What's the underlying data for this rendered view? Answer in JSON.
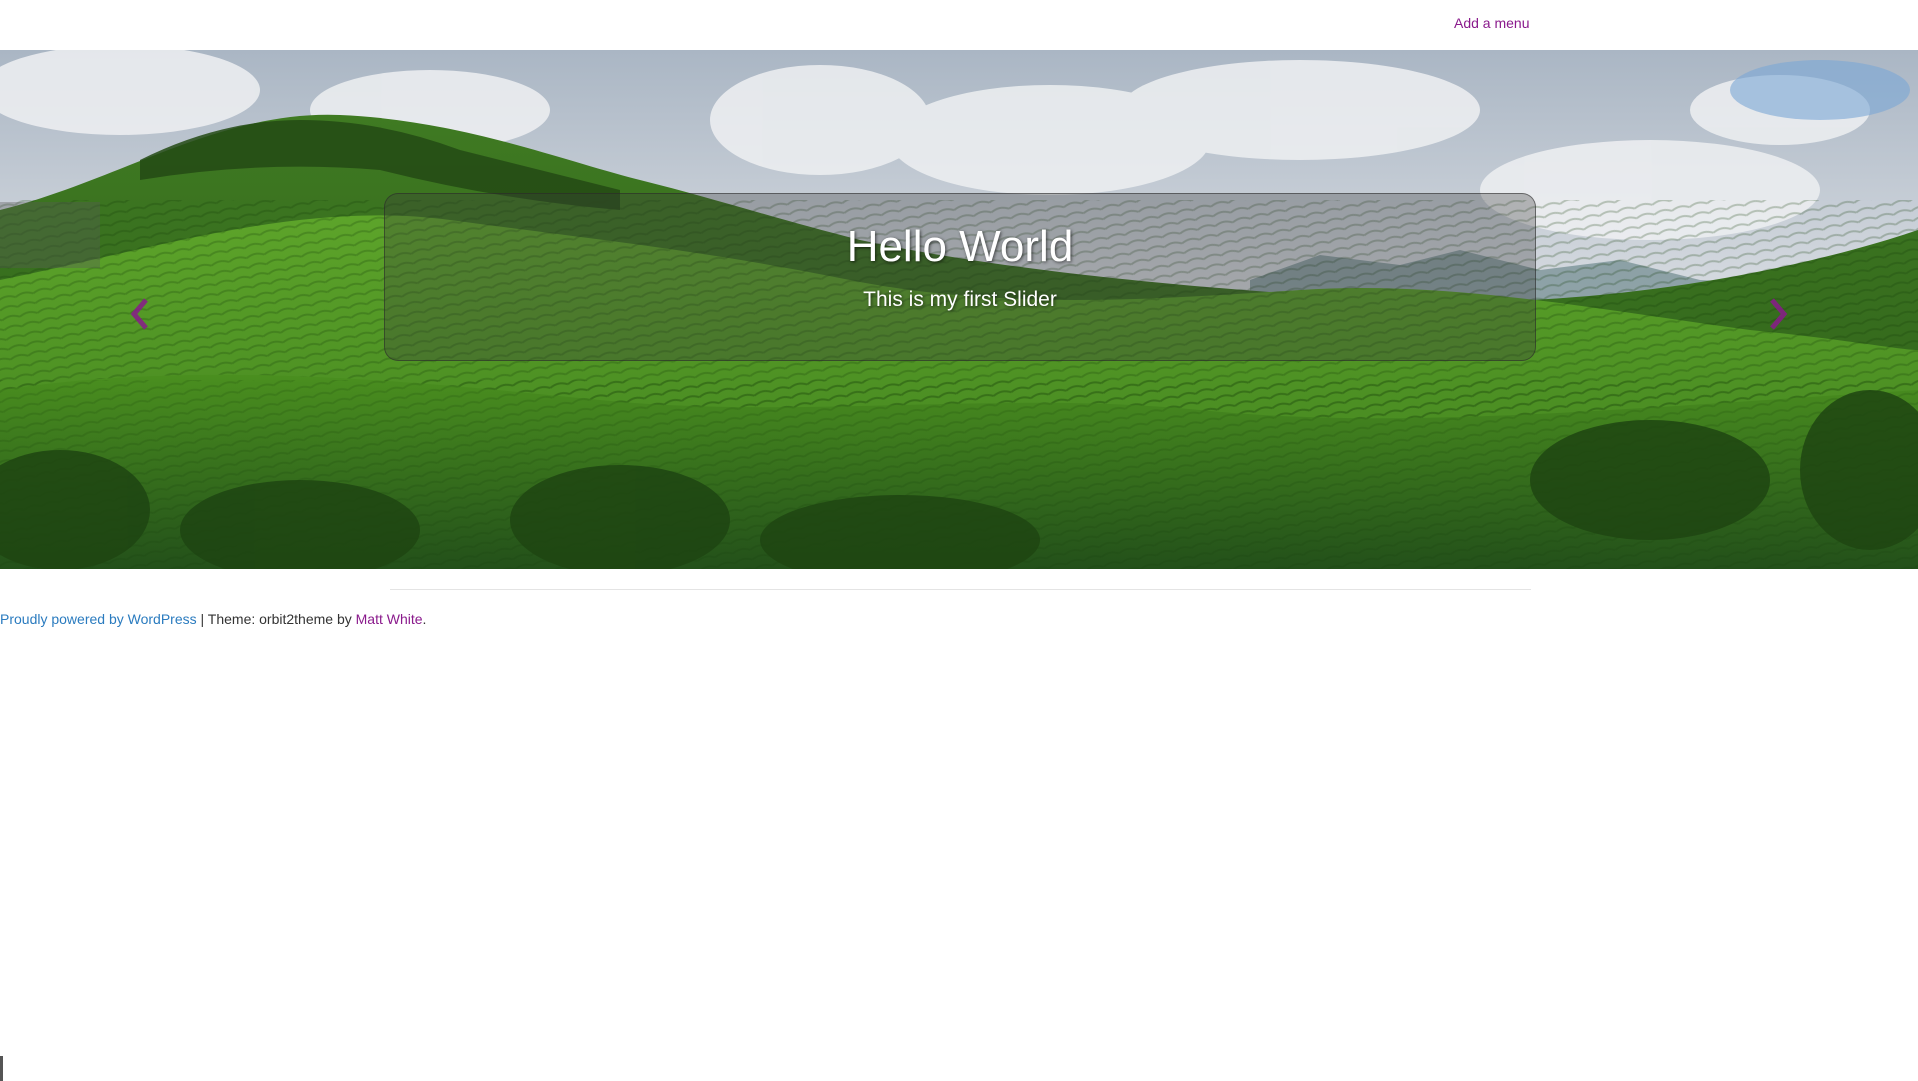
{
  "header": {
    "menu_link": "Add a menu"
  },
  "slider": {
    "title": "Hello World",
    "subtitle": "This is my first Slider",
    "prev_icon": "chevron-left-icon",
    "next_icon": "chevron-right-icon",
    "arrow_color": "#8a1a8c"
  },
  "footer": {
    "powered_by": "Proudly powered by WordPress",
    "separator": " | ",
    "theme_text": "Theme: orbit2theme by ",
    "author": "Matt White",
    "period": "."
  },
  "colors": {
    "link_purple": "#8a1a8c",
    "link_blue": "#2a7bbf",
    "text": "#333333"
  }
}
